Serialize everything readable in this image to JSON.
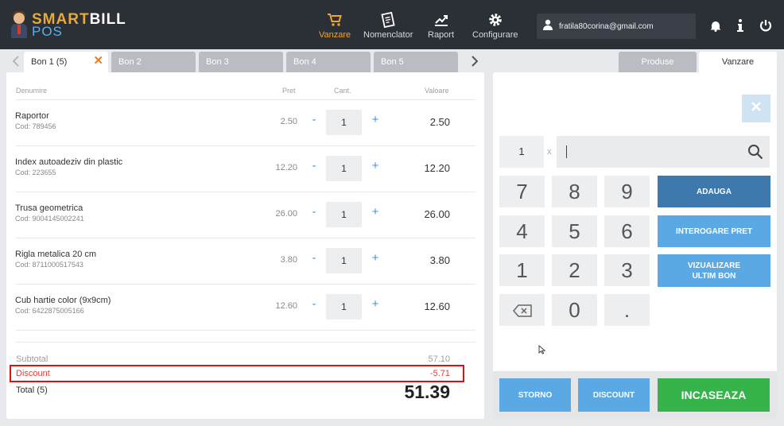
{
  "brand": {
    "smart": "SMART",
    "bill": "BILL",
    "pos": "POS"
  },
  "nav": [
    {
      "label": "Vanzare",
      "icon": "cart-icon",
      "active": true
    },
    {
      "label": "Nomenclator",
      "icon": "list-icon",
      "active": false
    },
    {
      "label": "Raport",
      "icon": "chart-icon",
      "active": false
    },
    {
      "label": "Configurare",
      "icon": "gear-icon",
      "active": false
    }
  ],
  "user": {
    "email": "fratila80corina@gmail.com"
  },
  "bon_tabs": [
    {
      "label": "Bon 1  (5)",
      "active": true
    },
    {
      "label": "Bon 2",
      "active": false
    },
    {
      "label": "Bon 3",
      "active": false
    },
    {
      "label": "Bon 4",
      "active": false
    },
    {
      "label": "Bon 5",
      "active": false
    }
  ],
  "side_tabs": {
    "produse": "Produse",
    "vanzare": "Vanzare"
  },
  "table": {
    "headers": {
      "name": "Denumire",
      "price": "Pret",
      "qty": "Cant.",
      "value": "Valoare"
    },
    "rows": [
      {
        "name": "Raportor",
        "code": "Cod: 789456",
        "price": "2.50",
        "qty": "1",
        "value": "2.50"
      },
      {
        "name": "Index autoadeziv din plastic",
        "code": "Cod: 223655",
        "price": "12.20",
        "qty": "1",
        "value": "12.20"
      },
      {
        "name": "Trusa geometrica",
        "code": "Cod: 9004145002241",
        "price": "26.00",
        "qty": "1",
        "value": "26.00"
      },
      {
        "name": "Rigla metalica 20 cm",
        "code": "Cod: 8711000517543",
        "price": "3.80",
        "qty": "1",
        "value": "3.80"
      },
      {
        "name": "Cub hartie color (9x9cm)",
        "code": "Cod: 6422875005166",
        "price": "12.60",
        "qty": "1",
        "value": "12.60"
      }
    ],
    "minus": "-",
    "plus": "+"
  },
  "summary": {
    "subtotal_label": "Subtotal",
    "subtotal": "57.10",
    "discount_label": "Discount",
    "discount": "-5.71",
    "total_label": "Total (5)",
    "total": "51.39"
  },
  "keypad": {
    "qty_value": "1",
    "times": "x",
    "search_value": "",
    "keys": [
      "7",
      "8",
      "9",
      "4",
      "5",
      "6",
      "1",
      "2",
      "3",
      "backspace",
      "0",
      "."
    ]
  },
  "actions": {
    "adauga": "ADAUGA",
    "interogare": "INTEROGARE PRET",
    "vizualizare": "VIZUALIZARE\nULTIM BON"
  },
  "bottom": {
    "storno": "STORNO",
    "discount": "DISCOUNT",
    "incaseaza": "INCASEAZA"
  },
  "colors": {
    "topbar": "#2b2f36",
    "accent_orange": "#f0a531",
    "blue_dark": "#3d79ad",
    "blue_light": "#5aa9e4",
    "green": "#36b34a",
    "discount_red": "#e0403c"
  }
}
